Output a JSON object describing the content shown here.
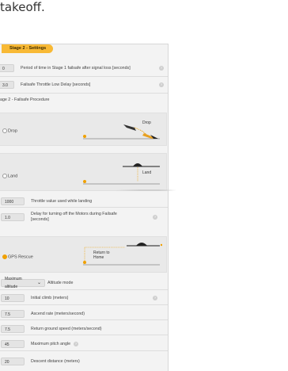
{
  "intro": {
    "text": "takeoff."
  },
  "panel": {
    "stage_tab": "Stage 2 - Settings",
    "rows_top": [
      {
        "value": "0",
        "label": "Period of time in Stage 1 failsafe after signal loss [seconds]"
      },
      {
        "value": "3.0",
        "label": "Failsafe Throttle Low Delay [seconds]"
      }
    ],
    "procedure_title": "age 2 - Failsafe Procedure",
    "options": {
      "drop": {
        "label": "Drop",
        "diagram_label": "Drop",
        "selected": false
      },
      "land": {
        "label": "Land",
        "diagram_label": "Land",
        "selected": false
      },
      "gps": {
        "label": "GPS Rescue",
        "diagram_label_1": "Return to",
        "diagram_label_2": "Home",
        "selected": true
      }
    },
    "land_rows": [
      {
        "value": "1000",
        "label": "Throttle value used while landing"
      },
      {
        "value": "1.0",
        "label_1": "Delay for turning off the Motors during Failsafe",
        "label_2": "[seconds]"
      }
    ],
    "altitude_select": {
      "value": "Maximum altitude",
      "label": "Altitude mode"
    },
    "gps_rows": [
      {
        "value": "10",
        "label": "Initial climb (meters)"
      },
      {
        "value": "7.5",
        "label": "Ascend rate (meters/second)"
      },
      {
        "value": "7.5",
        "label": "Return ground speed (meters/second)"
      },
      {
        "value": "45",
        "label": "Maximum pitch angle"
      },
      {
        "value": "20",
        "label": "Descent distance (meters)"
      }
    ],
    "help_glyph": "?",
    "chevron": "⌄",
    "accent": "#f8b935"
  }
}
